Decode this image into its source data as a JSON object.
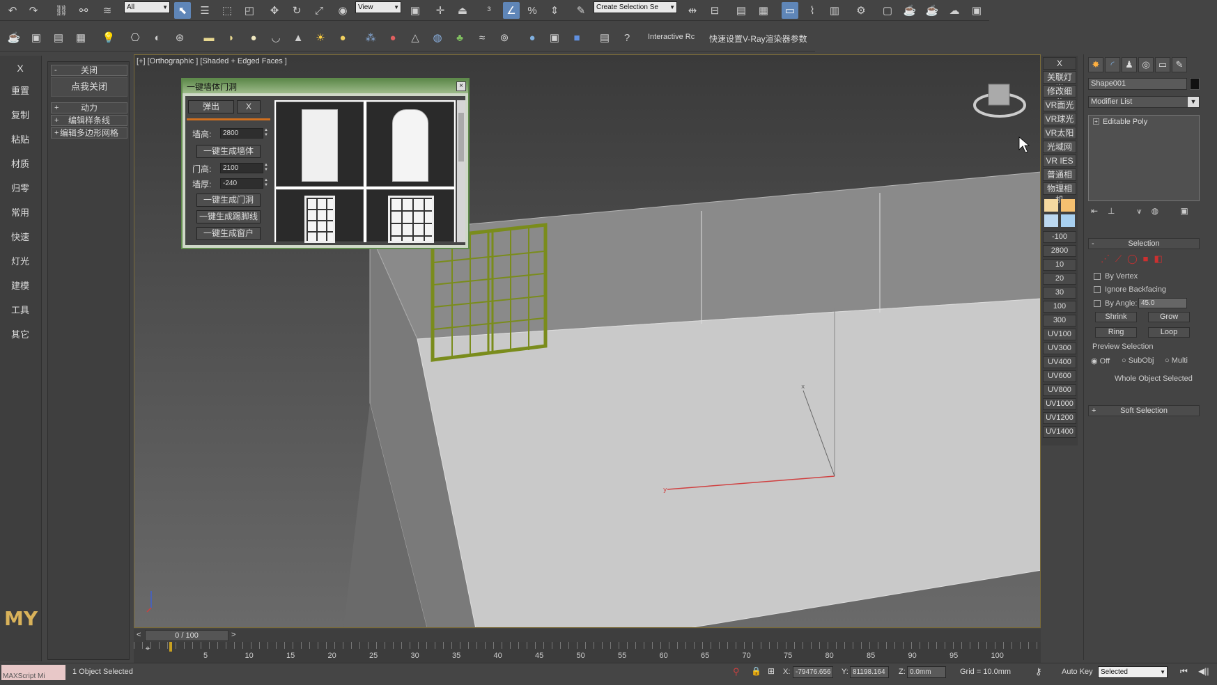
{
  "toolbar": {
    "selection_filter": "All",
    "ref_coord": "View",
    "named_selection": "Create Selection Se",
    "interactive_label": "Interactive Rc",
    "vray_quick": "快速设置V-Ray渲染器参数",
    "icons": [
      "undo-icon",
      "redo-icon",
      "link-icon",
      "unlink-icon",
      "bind-spacewarp-icon",
      "select-icon",
      "select-by-name-icon",
      "rect-select-icon",
      "window-crossing-icon",
      "move-icon",
      "rotate-icon",
      "scale-icon",
      "select-place-icon",
      "pivot-icon",
      "select-manipulate-icon",
      "keyboard-shortcut-icon",
      "snap-3-icon",
      "angle-snap-icon",
      "percent-snap-icon",
      "spinner-snap-icon",
      "edit-named-sel-icon",
      "mirror-icon",
      "align-icon",
      "layers-icon",
      "scene-explorer-icon",
      "curve-editor-icon",
      "schematic-icon",
      "material-editor-icon",
      "render-setup-icon",
      "render-frame-icon",
      "render-icon",
      "render-iterative-icon",
      "render-cloud-icon"
    ]
  },
  "toolbar2": {
    "icons": [
      "teapot-icon",
      "image-icon",
      "list-icon",
      "grid-icon",
      "light-bulb-icon",
      "camera-icon",
      "sphere-wire-icon",
      "film-icon",
      "box-icon",
      "dome-icon",
      "sphere-icon",
      "bowl-icon",
      "cone-icon",
      "sun-icon",
      "sphere-light-icon",
      "hair-icon",
      "mesh-icon",
      "proxy-icon",
      "sphere-lines-icon",
      "grass-icon",
      "fur-icon",
      "texture-icon",
      "shading-icon",
      "frame-icon",
      "vfb-icon",
      "clip-icon",
      "help-icon"
    ]
  },
  "left_sidebar": {
    "close_x": "X",
    "items": [
      "重置",
      "复制",
      "粘贴",
      "材质",
      "归零",
      "常用",
      "快速",
      "灯光",
      "建模",
      "工具",
      "其它"
    ],
    "logo": "MY"
  },
  "left_panel": {
    "close_roll": "关闭",
    "close_btn": "点我关闭",
    "rolls": [
      "动力",
      "编辑样条线",
      "编辑多边形网格"
    ]
  },
  "viewport": {
    "label": "[+] [Orthographic ] [Shaded + Edged Faces ]"
  },
  "dialog": {
    "title": "一键墙体门洞",
    "popup_btn": "弹出",
    "x_btn": "X",
    "wall_height_label": "墙高:",
    "wall_height": "2800",
    "gen_wall": "一键生成墙体",
    "door_height_label": "门高:",
    "door_height": "2100",
    "wall_thick_label": "墙厚:",
    "wall_thick": "-240",
    "gen_door": "一键生成门洞",
    "gen_skirting": "一键生成踢脚线",
    "gen_window": "一键生成窗户"
  },
  "right_strip": {
    "x": "X",
    "items": [
      "关联灯光",
      "修改细分",
      "VR面光",
      "VR球光",
      "VR太阳",
      "光域网",
      "VR IES",
      "普通相机",
      "物理相机"
    ],
    "swatches": [
      "#f5d9a0",
      "#f5c070",
      "#bcd8f0",
      "#a8d0f0"
    ],
    "numbers": [
      "-100",
      "2800",
      "10",
      "20",
      "30",
      "100",
      "300",
      "UV100",
      "UV300",
      "UV400",
      "UV600",
      "UV800",
      "UV1000",
      "UV1200",
      "UV1400"
    ]
  },
  "command_panel": {
    "object_name": "Shape001",
    "modifier_list": "Modifier List",
    "stack_item": "Editable Poly",
    "selection_title": "Selection",
    "by_vertex": "By Vertex",
    "ignore_backfacing": "Ignore Backfacing",
    "by_angle": "By Angle:",
    "angle_value": "45.0",
    "shrink": "Shrink",
    "grow": "Grow",
    "ring": "Ring",
    "loop": "Loop",
    "preview_selection": "Preview Selection",
    "off": "Off",
    "subobj": "SubObj",
    "multi": "Multi",
    "whole_selected": "Whole Object Selected",
    "soft_selection": "Soft Selection"
  },
  "timeline": {
    "frame": "0 / 100",
    "ticks": [
      "5",
      "10",
      "15",
      "20",
      "25",
      "30",
      "35",
      "40",
      "45",
      "50",
      "55",
      "60",
      "65",
      "70",
      "75",
      "80",
      "85",
      "90",
      "95",
      "100"
    ]
  },
  "status": {
    "maxscript": "MAXScript Mi",
    "selected": "1 Object Selected",
    "x_label": "X:",
    "x": "-79476.656",
    "y_label": "Y:",
    "y": "81198.164",
    "z_label": "Z:",
    "z": "0.0mm",
    "grid": "Grid = 10.0mm",
    "auto_key": "Auto Key",
    "key_filter": "Selected"
  }
}
